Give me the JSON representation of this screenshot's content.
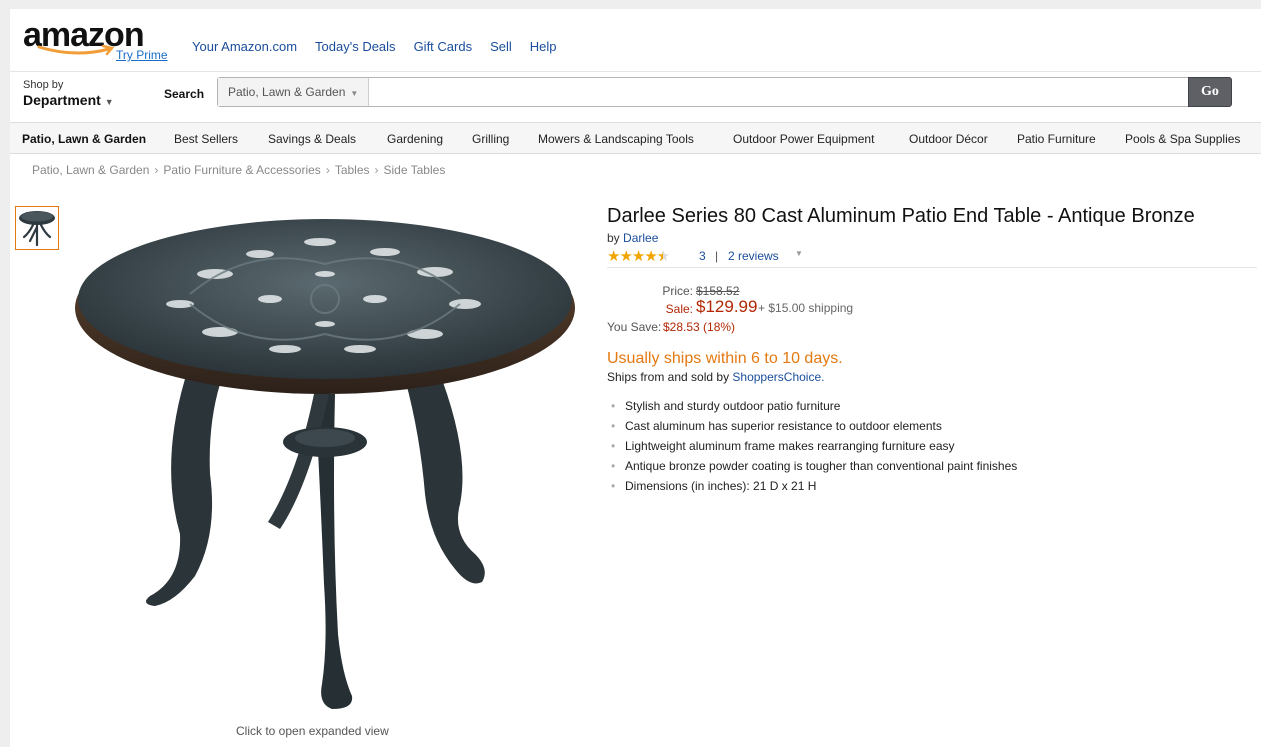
{
  "header": {
    "logo_text": "amazon",
    "try_prime": "Try Prime",
    "links": [
      "Your Amazon.com",
      "Today's Deals",
      "Gift Cards",
      "Sell",
      "Help"
    ]
  },
  "search": {
    "shop_by_small": "Shop by",
    "shop_by_big": "Department",
    "label": "Search",
    "category": "Patio, Lawn & Garden",
    "value": "",
    "go_label": "Go"
  },
  "category_bar": {
    "items": [
      "Patio, Lawn & Garden",
      "Best Sellers",
      "Savings & Deals",
      "Gardening",
      "Grilling",
      "Mowers & Landscaping Tools",
      "Outdoor Power Equipment",
      "Outdoor Décor",
      "Patio Furniture",
      "Pools & Spa Supplies"
    ]
  },
  "breadcrumb": [
    "Patio, Lawn & Garden",
    "Patio Furniture & Accessories",
    "Tables",
    "Side Tables"
  ],
  "product": {
    "title": "Darlee Series 80 Cast Aluminum Patio End Table - Antique Bronze",
    "by_prefix": "by",
    "brand": "Darlee",
    "rating": 4.5,
    "rating_count": "3",
    "separator": "|",
    "reviews_link": "2 reviews",
    "price_label": "Price:",
    "price": "$158.52",
    "sale_label": "Sale:",
    "sale_price": "$129.99",
    "shipping": "+ $15.00 shipping",
    "save_label": "You Save:",
    "save_value": "$28.53 (18%)",
    "availability": "Usually ships within 6 to 10 days.",
    "ships_from_prefix": "Ships from and sold by",
    "seller": "ShoppersChoice.",
    "features": [
      "Stylish and sturdy outdoor patio furniture",
      "Cast aluminum has superior resistance to outdoor elements",
      "Lightweight aluminum frame makes rearranging furniture easy",
      "Antique bronze powder coating is tougher than conventional paint finishes",
      "Dimensions (in inches): 21 D x 21 H"
    ],
    "expand_hint": "Click to open expanded view"
  },
  "colors": {
    "link": "#1a4d9c",
    "sale_red": "#b12704",
    "availability_orange": "#e47911",
    "star": "#f0a500"
  }
}
